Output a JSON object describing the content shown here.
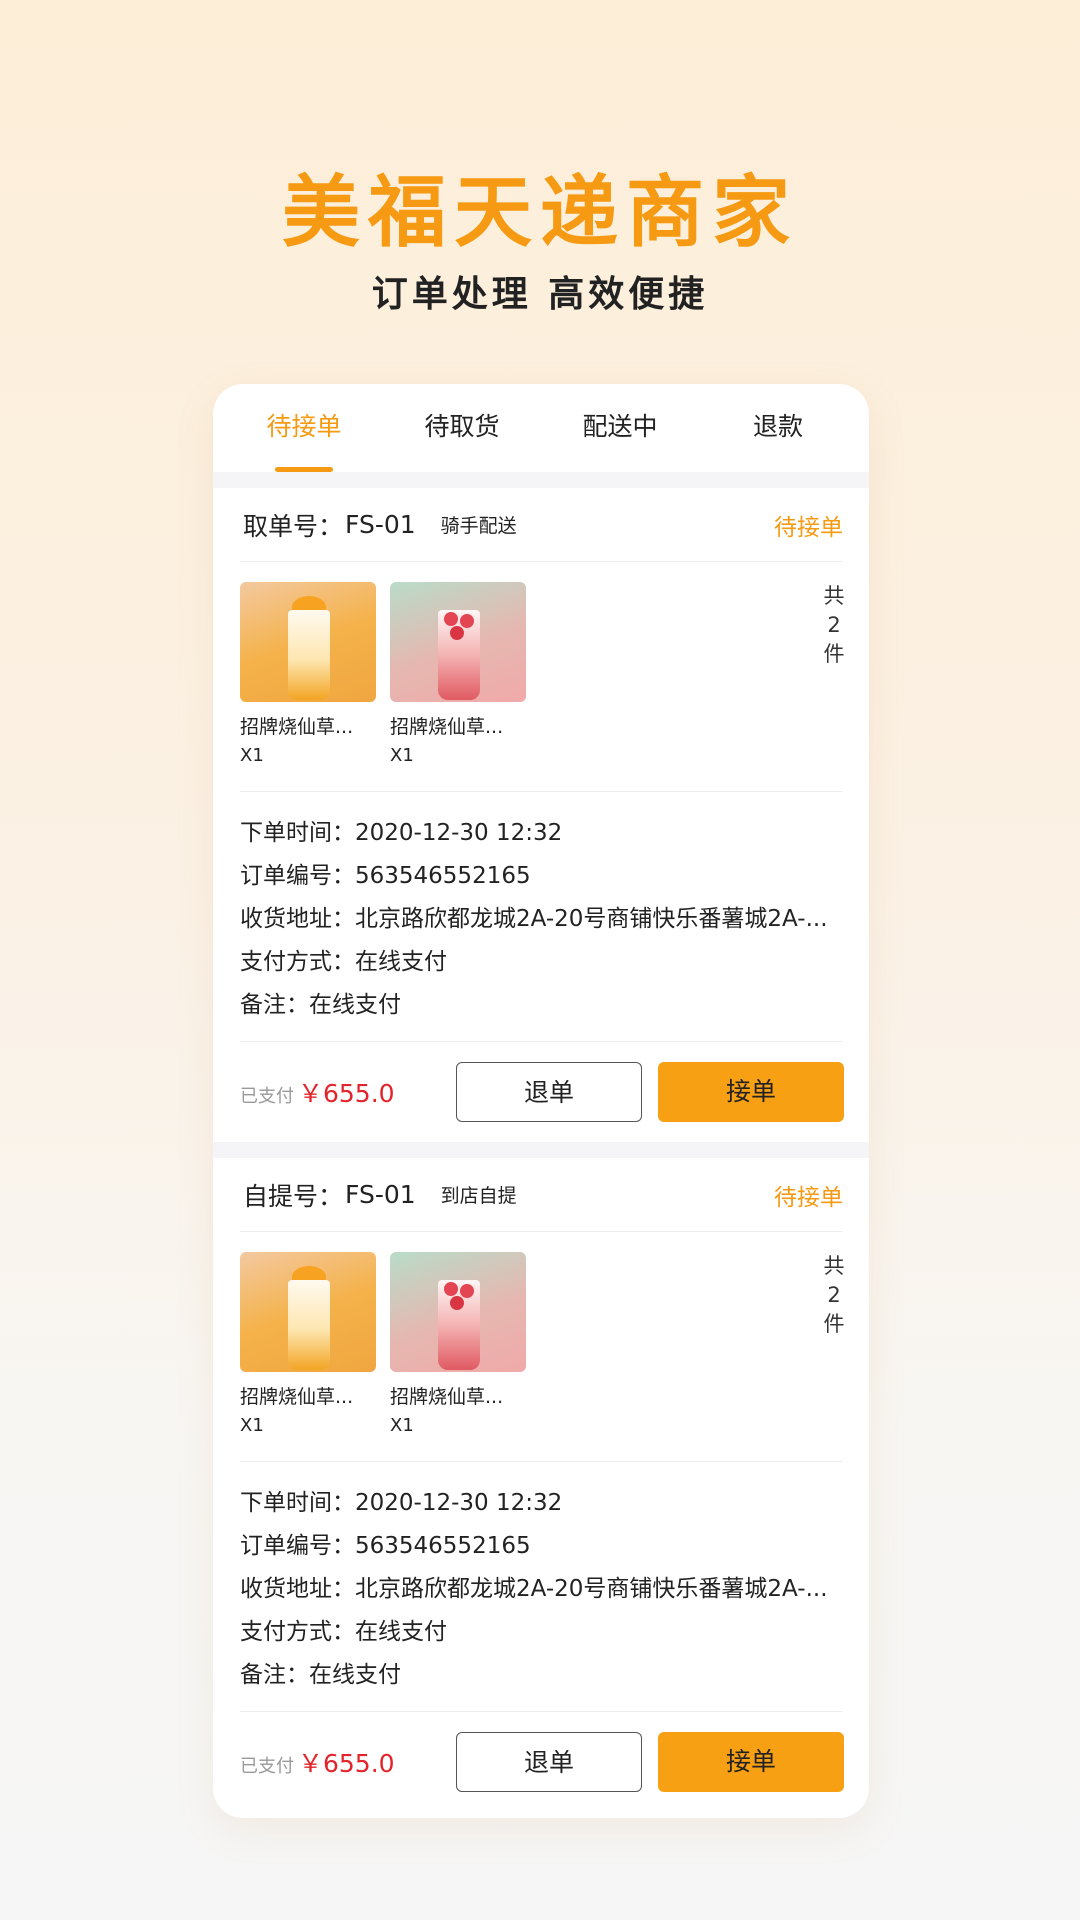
{
  "hero": {
    "title": "美福天递商家",
    "subtitle": "订单处理 高效便捷"
  },
  "tabs": [
    {
      "label": "待接单",
      "active": true
    },
    {
      "label": "待取货",
      "active": false
    },
    {
      "label": "配送中",
      "active": false
    },
    {
      "label": "退款",
      "active": false
    }
  ],
  "orders": [
    {
      "no_label": "取单号：",
      "no_value": "FS-01",
      "type": "骑手配送",
      "status": "待接单",
      "products": [
        {
          "name": "招牌烧仙草...",
          "qty": "X1",
          "image": "mango-drink"
        },
        {
          "name": "招牌烧仙草...",
          "qty": "X1",
          "image": "strawberry-drink"
        }
      ],
      "count": [
        "共",
        "2",
        "件"
      ],
      "info": {
        "time_label": "下单时间：",
        "time_value": "2020-12-30  12:32",
        "id_label": "订单编号：",
        "id_value": "563546552165",
        "addr_label": "收货地址：",
        "addr_value": "北京路欣都龙城2A-20号商铺快乐番薯城2A-...",
        "pay_label": "支付方式：",
        "pay_value": "在线支付",
        "note_label": "备注：",
        "note_value": "在线支付"
      },
      "paid_label": "已支付",
      "paid_amount": "￥655.0",
      "reject_label": "退单",
      "accept_label": "接单"
    },
    {
      "no_label": "自提号：",
      "no_value": "FS-01",
      "type": "到店自提",
      "status": "待接单",
      "products": [
        {
          "name": "招牌烧仙草...",
          "qty": "X1",
          "image": "mango-drink"
        },
        {
          "name": "招牌烧仙草...",
          "qty": "X1",
          "image": "strawberry-drink"
        }
      ],
      "count": [
        "共",
        "2",
        "件"
      ],
      "info": {
        "time_label": "下单时间：",
        "time_value": "2020-12-30  12:32",
        "id_label": "订单编号：",
        "id_value": "563546552165",
        "addr_label": "收货地址：",
        "addr_value": "北京路欣都龙城2A-20号商铺快乐番薯城2A-...",
        "pay_label": "支付方式：",
        "pay_value": "在线支付",
        "note_label": "备注：",
        "note_value": "在线支付"
      },
      "paid_label": "已支付",
      "paid_amount": "￥655.0",
      "reject_label": "退单",
      "accept_label": "接单"
    }
  ],
  "colors": {
    "accent": "#f59a12",
    "price": "#e3242b",
    "accept_button": "#f7a014"
  }
}
